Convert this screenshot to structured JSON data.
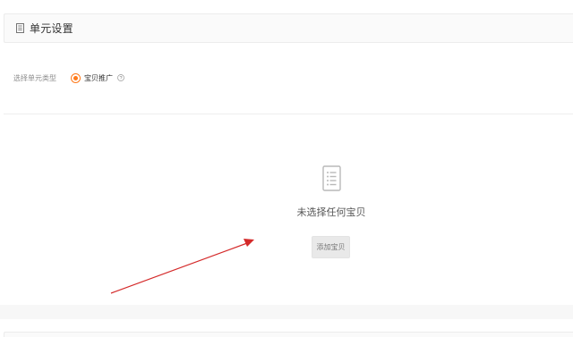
{
  "section": {
    "title": "单元设置",
    "icon": "document-icon"
  },
  "unit_type": {
    "label": "选择单元类型",
    "options": [
      {
        "label": "宝贝推广",
        "selected": true
      }
    ],
    "help_icon": "question-circle-icon",
    "accent_color": "#ff7a1a"
  },
  "empty_state": {
    "icon": "document-list-icon",
    "message": "未选择任何宝贝",
    "button_label": "添加宝贝"
  },
  "annotation": {
    "type": "arrow",
    "color": "#d42a2a"
  }
}
